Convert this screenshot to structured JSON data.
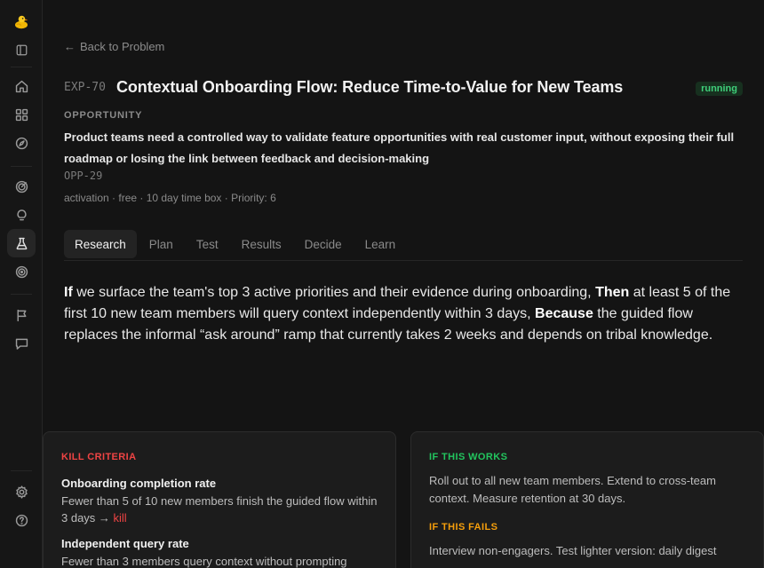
{
  "sidebar": {
    "items": [
      {
        "icon": "home-icon"
      },
      {
        "icon": "dashboard-icon"
      },
      {
        "icon": "compass-icon"
      },
      {
        "icon": "radar-icon"
      },
      {
        "icon": "lightbulb-icon"
      },
      {
        "icon": "flask-icon",
        "active": true
      },
      {
        "icon": "target-icon"
      },
      {
        "icon": "flag-icon"
      },
      {
        "icon": "chat-icon"
      },
      {
        "icon": "settings-icon"
      },
      {
        "icon": "help-icon"
      }
    ]
  },
  "nav": {
    "back_label": "Back to Problem"
  },
  "experiment": {
    "id": "EXP-70",
    "title": "Contextual Onboarding Flow: Reduce Time-to-Value for New Teams",
    "status": "running",
    "status_color": "#3fcf7a"
  },
  "opportunity": {
    "label": "OPPORTUNITY",
    "text": "Product teams need a controlled way to validate feature opportunities with real customer input, without exposing their full roadmap or losing the link between feedback and decision-making",
    "id": "OPP-29",
    "meta": "activation · free · 10 day time box · Priority: 6"
  },
  "tabs": [
    {
      "label": "Research",
      "active": true
    },
    {
      "label": "Plan"
    },
    {
      "label": "Test"
    },
    {
      "label": "Results"
    },
    {
      "label": "Decide"
    },
    {
      "label": "Learn"
    }
  ],
  "hypothesis": {
    "if_kw": "If",
    "if_text": " we surface the team's top 3 active priorities and their evidence during onboarding, ",
    "then_kw": "Then",
    "then_text": " at least 5 of the first 10 new team members will query context independently within 3 days, ",
    "because_kw": "Because",
    "because_text": " the guided flow replaces the informal “ask around” ramp that currently takes 2 weeks and depends on tribal knowledge."
  },
  "kill_criteria": {
    "label": "KILL CRITERIA",
    "color": "#ef4444",
    "items": [
      {
        "title": "Onboarding completion rate",
        "desc": "Fewer than 5 of 10 new members finish the guided flow within 3 days → ",
        "action": "kill"
      },
      {
        "title": "Independent query rate",
        "desc": "Fewer than 3 members query context without prompting"
      }
    ]
  },
  "outcomes": {
    "works_label": "IF THIS WORKS",
    "works_color": "#22c55e",
    "works_text": "Roll out to all new team members. Extend to cross-team context. Measure retention at 30 days.",
    "fails_label": "IF THIS FAILS",
    "fails_color": "#f59e0b",
    "fails_text": "Interview non-engagers. Test lighter version: daily digest"
  }
}
